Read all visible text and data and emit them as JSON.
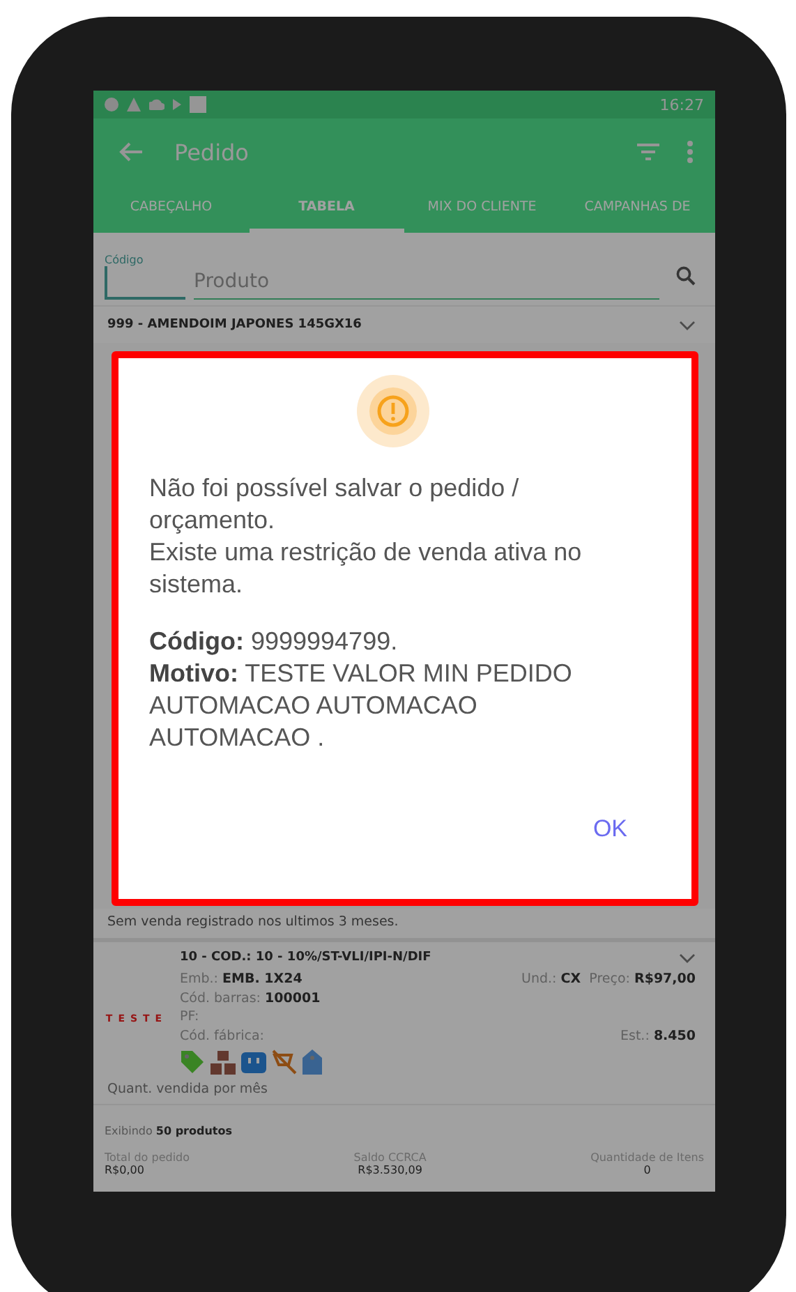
{
  "status_bar": {
    "time": "16:27"
  },
  "app_bar": {
    "title": "Pedido"
  },
  "tabs": [
    {
      "label": "CABEÇALHO",
      "selected": false
    },
    {
      "label": "TABELA",
      "selected": true
    },
    {
      "label": "MIX DO CLIENTE",
      "selected": false
    },
    {
      "label": "CAMPANHAS DE",
      "selected": false
    }
  ],
  "search": {
    "code_label": "Código",
    "product_placeholder": "Produto"
  },
  "first_product": {
    "title": "999 - AMENDOIM JAPONES 145GX16"
  },
  "sales_note": "Sem venda registrado nos ultimos 3 meses.",
  "product": {
    "title": "10 - COD.: 10 - 10%/ST-VLI/IPI-N/DIF",
    "brand": "TESTE",
    "left_fields": [
      {
        "label": "Emb.:",
        "value": "EMB. 1X24"
      },
      {
        "label": "Cód. barras:",
        "value": "100001"
      },
      {
        "label": "PF:"
      },
      {
        "label": "Cód. fábrica:"
      }
    ],
    "unit": {
      "label": "Und.:",
      "value": "CX"
    },
    "price": {
      "label": "Preço:",
      "value": "R$97,00"
    },
    "stock": {
      "label": "Est.:",
      "value": "8.450"
    },
    "monthly_label": "Quant. vendida por mês"
  },
  "footer": {
    "showing": "Exibindo **50 produtos**",
    "totals": [
      {
        "label": "Total do pedido",
        "value": "R$0,00"
      },
      {
        "label": "Saldo CCRCA",
        "value": "R$3.530,09"
      },
      {
        "label": "Quantidade de Itens",
        "value": "0"
      }
    ]
  },
  "dialog": {
    "paragraphs": [
      "Não foi possível salvar o pedido / orçamento.\nExiste uma restrição de venda ativa no sistema.",
      "**Código:** 9999994799.\n**Motivo:** TESTE VALOR MIN PEDIDO AUTOMACAO AUTOMACAO AUTOMACAO ."
    ],
    "button": "OK"
  }
}
